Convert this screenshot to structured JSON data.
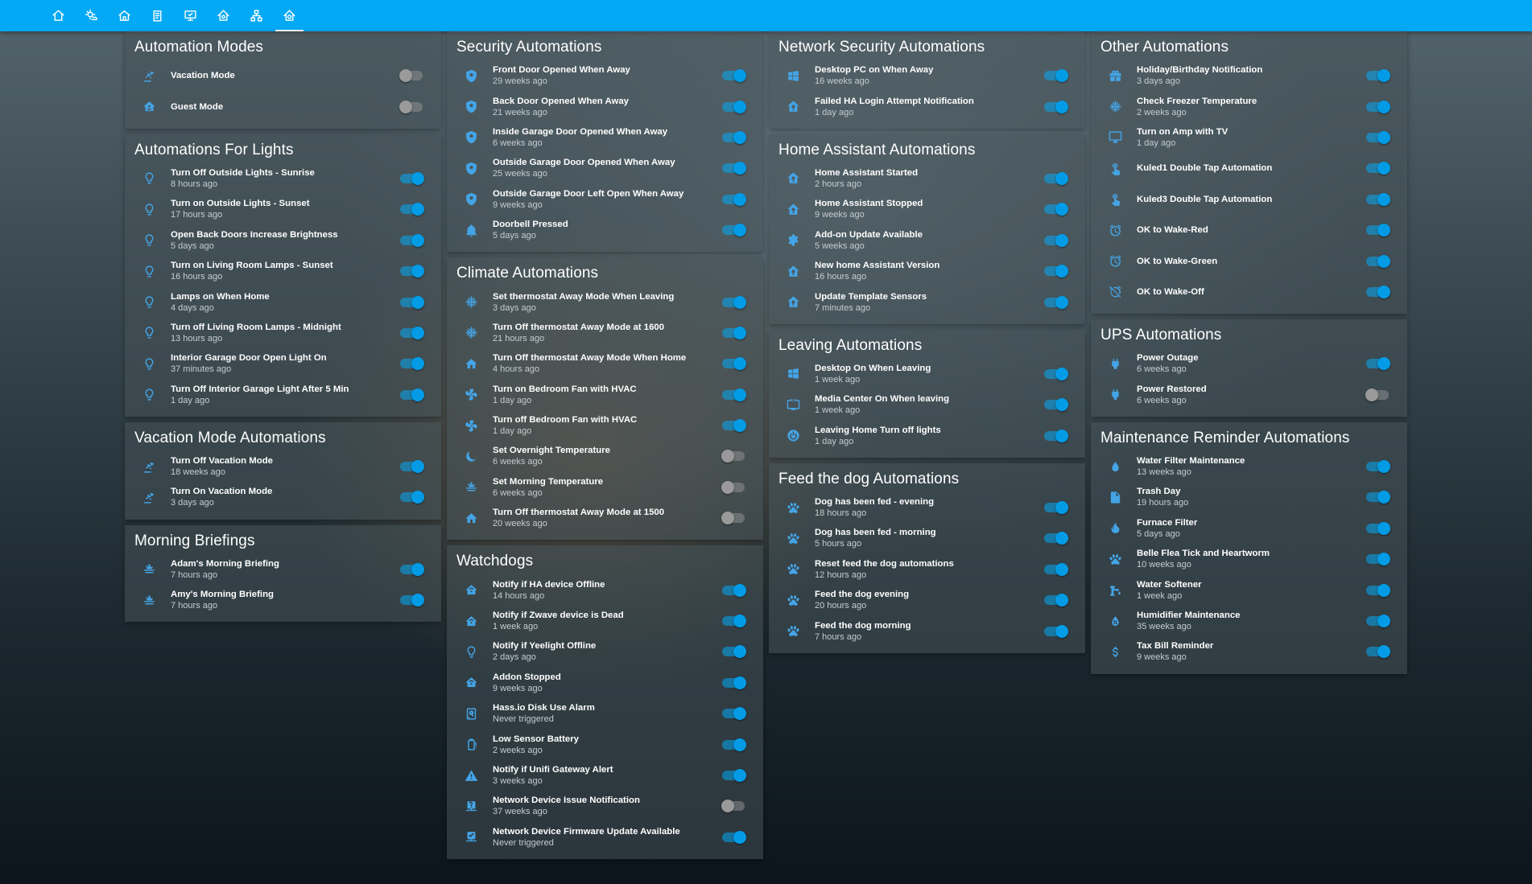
{
  "nav": {
    "tabs": [
      {
        "icon": "home-icon"
      },
      {
        "icon": "weather-icon"
      },
      {
        "icon": "house-icon"
      },
      {
        "icon": "clipboard-icon"
      },
      {
        "icon": "monitor-icon"
      },
      {
        "icon": "home-automation-icon"
      },
      {
        "icon": "network-icon"
      },
      {
        "icon": "home-gear-icon",
        "active": true
      }
    ]
  },
  "colors": {
    "accent": "#03a9f4",
    "icon": "#44a4e6",
    "toggle_on": "#039be5",
    "toggle_off": "#9a9a9a"
  },
  "columns": [
    [
      {
        "title": "Automation Modes",
        "items": [
          {
            "name": "Vacation Mode",
            "time": "",
            "icon": "beach-icon",
            "on": false
          },
          {
            "name": "Guest Mode",
            "time": "",
            "icon": "home-account-icon",
            "on": false
          }
        ]
      },
      {
        "title": "Automations For Lights",
        "items": [
          {
            "name": "Turn Off Outside Lights - Sunrise",
            "time": "8 hours ago",
            "icon": "lightbulb-icon",
            "on": true
          },
          {
            "name": "Turn on Outside Lights - Sunset",
            "time": "17 hours ago",
            "icon": "lightbulb-icon",
            "on": true
          },
          {
            "name": "Open Back Doors Increase Brightness",
            "time": "5 days ago",
            "icon": "lightbulb-icon",
            "on": true
          },
          {
            "name": "Turn on Living Room Lamps - Sunset",
            "time": "16 hours ago",
            "icon": "lightbulb-icon",
            "on": true
          },
          {
            "name": "Lamps on When Home",
            "time": "4 days ago",
            "icon": "lightbulb-icon",
            "on": true
          },
          {
            "name": "Turn off Living Room Lamps - Midnight",
            "time": "13 hours ago",
            "icon": "lightbulb-icon",
            "on": true
          },
          {
            "name": "Interior Garage Door Open Light On",
            "time": "37 minutes ago",
            "icon": "lightbulb-icon",
            "on": true
          },
          {
            "name": "Turn Off Interior Garage Light After 5 Min",
            "time": "1 day ago",
            "icon": "lightbulb-icon",
            "on": true
          }
        ]
      },
      {
        "title": "Vacation Mode Automations",
        "items": [
          {
            "name": "Turn Off Vacation Mode",
            "time": "18 weeks ago",
            "icon": "beach-icon",
            "on": true
          },
          {
            "name": "Turn On Vacation Mode",
            "time": "3 days ago",
            "icon": "beach-icon",
            "on": true
          }
        ]
      },
      {
        "title": "Morning Briefings",
        "items": [
          {
            "name": "Adam's Morning Briefing",
            "time": "7 hours ago",
            "icon": "sunrise-icon",
            "on": true
          },
          {
            "name": "Amy's Morning Briefing",
            "time": "7 hours ago",
            "icon": "sunrise-icon",
            "on": true
          }
        ]
      }
    ],
    [
      {
        "title": "Security Automations",
        "items": [
          {
            "name": "Front Door Opened When Away",
            "time": "29 weeks ago",
            "icon": "shield-icon",
            "on": true
          },
          {
            "name": "Back Door Opened When Away",
            "time": "21 weeks ago",
            "icon": "shield-icon",
            "on": true
          },
          {
            "name": "Inside Garage Door Opened When Away",
            "time": "6 weeks ago",
            "icon": "shield-icon",
            "on": true
          },
          {
            "name": "Outside Garage Door Opened When Away",
            "time": "25 weeks ago",
            "icon": "shield-icon",
            "on": true
          },
          {
            "name": "Outside Garage Door Left Open When Away",
            "time": "9 weeks ago",
            "icon": "shield-icon",
            "on": true
          },
          {
            "name": "Doorbell Pressed",
            "time": "5 days ago",
            "icon": "bell-icon",
            "on": true
          }
        ]
      },
      {
        "title": "Climate Automations",
        "items": [
          {
            "name": "Set thermostat Away Mode When Leaving",
            "time": "3 days ago",
            "icon": "snowflake-icon",
            "on": true
          },
          {
            "name": "Turn Off thermostat Away Mode at 1600",
            "time": "21 hours ago",
            "icon": "snowflake-icon",
            "on": true
          },
          {
            "name": "Turn Off thermostat Away Mode When Home",
            "time": "4 hours ago",
            "icon": "home-icon",
            "on": true
          },
          {
            "name": "Turn on Bedroom Fan with HVAC",
            "time": "1 day ago",
            "icon": "fan-icon",
            "on": true
          },
          {
            "name": "Turn off Bedroom Fan with HVAC",
            "time": "1 day ago",
            "icon": "fan-icon",
            "on": true
          },
          {
            "name": "Set Overnight Temperature",
            "time": "6 weeks ago",
            "icon": "moon-icon",
            "on": false
          },
          {
            "name": "Set Morning Temperature",
            "time": "6 weeks ago",
            "icon": "sunrise-icon",
            "on": false
          },
          {
            "name": "Turn Off thermostat Away Mode at 1500",
            "time": "20 weeks ago",
            "icon": "home-icon",
            "on": false
          }
        ]
      },
      {
        "title": "Watchdogs",
        "items": [
          {
            "name": "Notify if HA device Offline",
            "time": "14 hours ago",
            "icon": "home-automation-icon",
            "on": true
          },
          {
            "name": "Notify if Zwave device is Dead",
            "time": "1 week ago",
            "icon": "home-automation-icon",
            "on": true
          },
          {
            "name": "Notify if Yeelight Offline",
            "time": "2 days ago",
            "icon": "lightbulb-icon",
            "on": true
          },
          {
            "name": "Addon Stopped",
            "time": "9 weeks ago",
            "icon": "home-automation-icon",
            "on": true
          },
          {
            "name": "Hass.io Disk Use Alarm",
            "time": "Never triggered",
            "icon": "harddisk-icon",
            "on": true
          },
          {
            "name": "Low Sensor Battery",
            "time": "2 weeks ago",
            "icon": "battery-icon",
            "on": true
          },
          {
            "name": "Notify if Unifi Gateway Alert",
            "time": "3 weeks ago",
            "icon": "alert-icon",
            "on": true
          },
          {
            "name": "Network Device Issue Notification",
            "time": "37 weeks ago",
            "icon": "network-question-icon",
            "on": false
          },
          {
            "name": "Network Device Firmware Update Available",
            "time": "Never triggered",
            "icon": "network-check-icon",
            "on": true
          }
        ]
      }
    ],
    [
      {
        "title": "Network Security Automations",
        "items": [
          {
            "name": "Desktop PC on When Away",
            "time": "16 weeks ago",
            "icon": "windows-icon",
            "on": true
          },
          {
            "name": "Failed HA Login Attempt Notification",
            "time": "1 day ago",
            "icon": "home-assistant-icon",
            "on": true
          }
        ]
      },
      {
        "title": "Home Assistant Automations",
        "items": [
          {
            "name": "Home Assistant Started",
            "time": "2 hours ago",
            "icon": "home-assistant-icon",
            "on": true
          },
          {
            "name": "Home Assistant Stopped",
            "time": "9 weeks ago",
            "icon": "home-assistant-icon",
            "on": true
          },
          {
            "name": "Add-on Update Available",
            "time": "5 weeks ago",
            "icon": "cog-icon",
            "on": true
          },
          {
            "name": "New home Assistant Version",
            "time": "16 hours ago",
            "icon": "home-assistant-icon",
            "on": true
          },
          {
            "name": "Update Template Sensors",
            "time": "7 minutes ago",
            "icon": "home-assistant-icon",
            "on": true
          }
        ]
      },
      {
        "title": "Leaving Automations",
        "items": [
          {
            "name": "Desktop On When Leaving",
            "time": "1 week ago",
            "icon": "windows-icon",
            "on": true
          },
          {
            "name": "Media Center On When leaving",
            "time": "1 week ago",
            "icon": "tv-icon",
            "on": true
          },
          {
            "name": "Leaving Home Turn off lights",
            "time": "1 day ago",
            "icon": "power-icon",
            "on": true
          }
        ]
      },
      {
        "title": "Feed the dog Automations",
        "items": [
          {
            "name": "Dog has been fed - evening",
            "time": "18 hours ago",
            "icon": "paw-icon",
            "on": true
          },
          {
            "name": "Dog has been fed - morning",
            "time": "5 hours ago",
            "icon": "paw-icon",
            "on": true
          },
          {
            "name": "Reset feed the dog automations",
            "time": "12 hours ago",
            "icon": "paw-icon",
            "on": true
          },
          {
            "name": "Feed the dog evening",
            "time": "20 hours ago",
            "icon": "paw-icon",
            "on": true
          },
          {
            "name": "Feed the dog morning",
            "time": "7 hours ago",
            "icon": "paw-icon",
            "on": true
          }
        ]
      }
    ],
    [
      {
        "title": "Other Automations",
        "items": [
          {
            "name": "Holiday/Birthday Notification",
            "time": "3 days ago",
            "icon": "gift-icon",
            "on": true
          },
          {
            "name": "Check Freezer Temperature",
            "time": "2 weeks ago",
            "icon": "snowflake-icon",
            "on": true
          },
          {
            "name": "Turn on Amp with TV",
            "time": "1 day ago",
            "icon": "monitor-icon",
            "on": true
          },
          {
            "name": "Kuled1 Double Tap Automation",
            "time": "",
            "icon": "touch-icon",
            "on": true
          },
          {
            "name": "Kuled3 Double Tap Automation",
            "time": "",
            "icon": "touch-icon",
            "on": true
          },
          {
            "name": "OK to Wake-Red",
            "time": "",
            "icon": "alarm-icon",
            "on": true
          },
          {
            "name": "OK to Wake-Green",
            "time": "",
            "icon": "alarm-icon",
            "on": true
          },
          {
            "name": "OK to Wake-Off",
            "time": "",
            "icon": "alarm-off-icon",
            "on": true
          }
        ]
      },
      {
        "title": "UPS Automations",
        "items": [
          {
            "name": "Power Outage",
            "time": "6 weeks ago",
            "icon": "plug-icon",
            "on": true
          },
          {
            "name": "Power Restored",
            "time": "6 weeks ago",
            "icon": "plug-icon",
            "on": false
          }
        ]
      },
      {
        "title": "Maintenance Reminder Automations",
        "items": [
          {
            "name": "Water Filter Maintenance",
            "time": "13 weeks ago",
            "icon": "water-drop-icon",
            "on": true
          },
          {
            "name": "Trash Day",
            "time": "19 hours ago",
            "icon": "trash-icon",
            "on": true
          },
          {
            "name": "Furnace Filter",
            "time": "5 days ago",
            "icon": "fire-icon",
            "on": true
          },
          {
            "name": "Belle Flea Tick and Heartworm",
            "time": "10 weeks ago",
            "icon": "paw-icon",
            "on": true
          },
          {
            "name": "Water Softener",
            "time": "1 week ago",
            "icon": "water-pump-icon",
            "on": true
          },
          {
            "name": "Humidifier Maintenance",
            "time": "35 weeks ago",
            "icon": "water-percent-icon",
            "on": true
          },
          {
            "name": "Tax Bill Reminder",
            "time": "9 weeks ago",
            "icon": "dollar-icon",
            "on": true
          }
        ]
      }
    ]
  ]
}
